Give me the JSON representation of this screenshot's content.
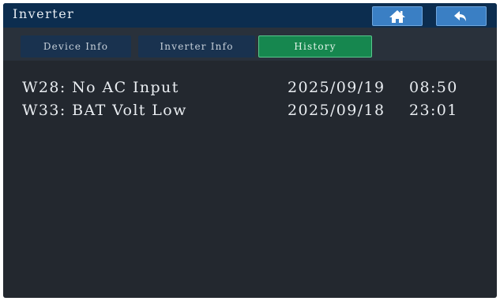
{
  "header": {
    "title": "Inverter",
    "home_icon": "home-icon",
    "back_icon": "back-arrow-icon"
  },
  "tabs": [
    {
      "label": "Device Info",
      "active": false
    },
    {
      "label": "Inverter Info",
      "active": false
    },
    {
      "label": "History",
      "active": true
    }
  ],
  "history": [
    {
      "message": "W28: No AC Input",
      "date": "2025/09/19",
      "time": "08:50"
    },
    {
      "message": "W33: BAT Volt Low",
      "date": "2025/09/18",
      "time": "23:01"
    }
  ],
  "colors": {
    "background": "#23282f",
    "header": "#0c2d4f",
    "button": "#3a7fc4",
    "tab_inactive": "#19324f",
    "tab_active": "#16874f"
  }
}
